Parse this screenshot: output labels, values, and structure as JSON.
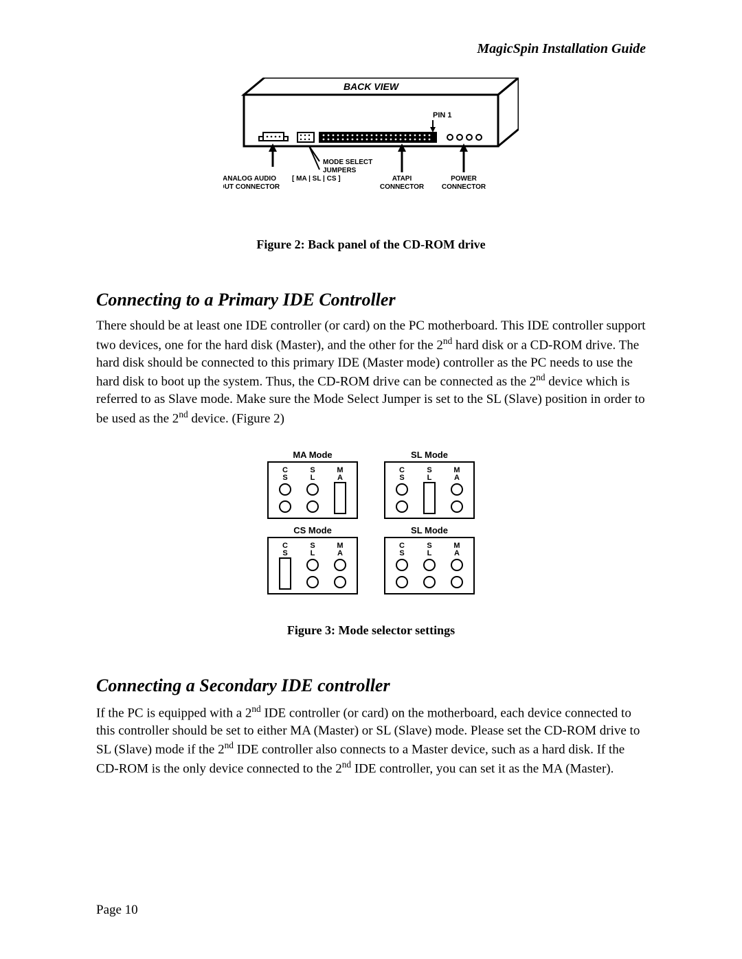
{
  "header": "MagicSpin Installation Guide",
  "figure2": {
    "title": "BACK VIEW",
    "pin1": "PIN 1",
    "modeSelect1": "MODE SELECT",
    "modeSelect2": "JUMPERS",
    "modeSelect3": "[ MA | SL | CS ]",
    "analog1": "ANALOG AUDIO",
    "analog2": "OUT CONNECTOR",
    "atapi1": "ATAPI",
    "atapi2": "CONNECTOR",
    "power1": "POWER",
    "power2": "CONNECTOR",
    "caption": "Figure 2: Back panel of the CD-ROM drive"
  },
  "section1": {
    "heading": "Connecting to a Primary IDE Controller",
    "para_a": "There should be at least one IDE controller (or card) on the PC motherboard.  This IDE controller support two devices, one for the hard disk (Master), and the other for the 2",
    "para_b": " hard disk or a CD-ROM drive.  The hard disk should be connected to this primary IDE (Master mode) controller as the PC needs to use the hard disk to boot up the system.  Thus, the CD-ROM drive can be connected as the 2",
    "para_c": " device which is referred to as Slave mode.  Make sure the Mode Select Jumper is set to the SL (Slave) position in order to be used as the 2",
    "para_d": " device.  (Figure 2)",
    "sup": "nd"
  },
  "figure3": {
    "ma": "MA Mode",
    "sl": "SL Mode",
    "cs": "CS Mode",
    "colCS1": "C",
    "colCS2": "S",
    "colSL1": "S",
    "colSL2": "L",
    "colMA1": "M",
    "colMA2": "A",
    "caption": "Figure 3: Mode selector settings"
  },
  "section2": {
    "heading": "Connecting a Secondary IDE controller",
    "para_a": "If the PC is equipped with a 2",
    "para_b": " IDE controller (or card) on the motherboard, each device connected to this controller should be set to either MA (Master) or SL (Slave) mode.  Please set the CD-ROM drive to SL (Slave) mode if the 2",
    "para_c": " IDE controller also connects to a Master device, such as a hard disk.  If the CD-ROM is the only device connected to the 2",
    "para_d": " IDE controller, you can set it as the MA (Master).",
    "sup": "nd"
  },
  "footer": "Page 10"
}
